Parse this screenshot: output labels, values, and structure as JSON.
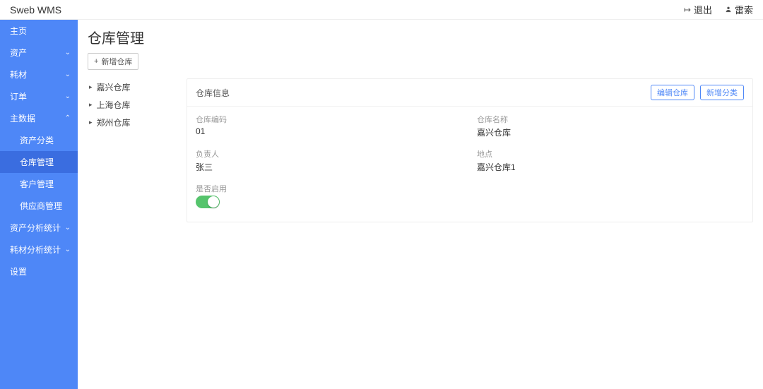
{
  "topbar": {
    "brand": "Sweb WMS",
    "logout": "退出",
    "user": "雷索"
  },
  "sidebar": {
    "items": [
      {
        "label": "主页",
        "collapsible": false
      },
      {
        "label": "资产",
        "collapsible": true,
        "open": false
      },
      {
        "label": "耗材",
        "collapsible": true,
        "open": false
      },
      {
        "label": "订单",
        "collapsible": true,
        "open": false
      },
      {
        "label": "主数据",
        "collapsible": true,
        "open": true,
        "children": [
          {
            "label": "资产分类",
            "active": false
          },
          {
            "label": "仓库管理",
            "active": true
          },
          {
            "label": "客户管理",
            "active": false
          },
          {
            "label": "供应商管理",
            "active": false
          }
        ]
      },
      {
        "label": "资产分析统计",
        "collapsible": true,
        "open": false
      },
      {
        "label": "耗材分析统计",
        "collapsible": true,
        "open": false
      },
      {
        "label": "设置",
        "collapsible": false
      }
    ]
  },
  "page": {
    "title": "仓库管理",
    "add_btn": "新增仓库"
  },
  "tree": {
    "items": [
      {
        "label": "嘉兴仓库"
      },
      {
        "label": "上海仓库"
      },
      {
        "label": "郑州仓库"
      }
    ]
  },
  "detail": {
    "header_title": "仓库信息",
    "edit_btn": "编辑仓库",
    "newcat_btn": "新增分类",
    "labels": {
      "code": "仓库编码",
      "name": "仓库名称",
      "owner": "负责人",
      "location": "地点",
      "enabled": "是否启用"
    },
    "values": {
      "code": "01",
      "name": "嘉兴仓库",
      "owner": "张三",
      "location": "嘉兴仓库1",
      "enabled": true
    }
  }
}
